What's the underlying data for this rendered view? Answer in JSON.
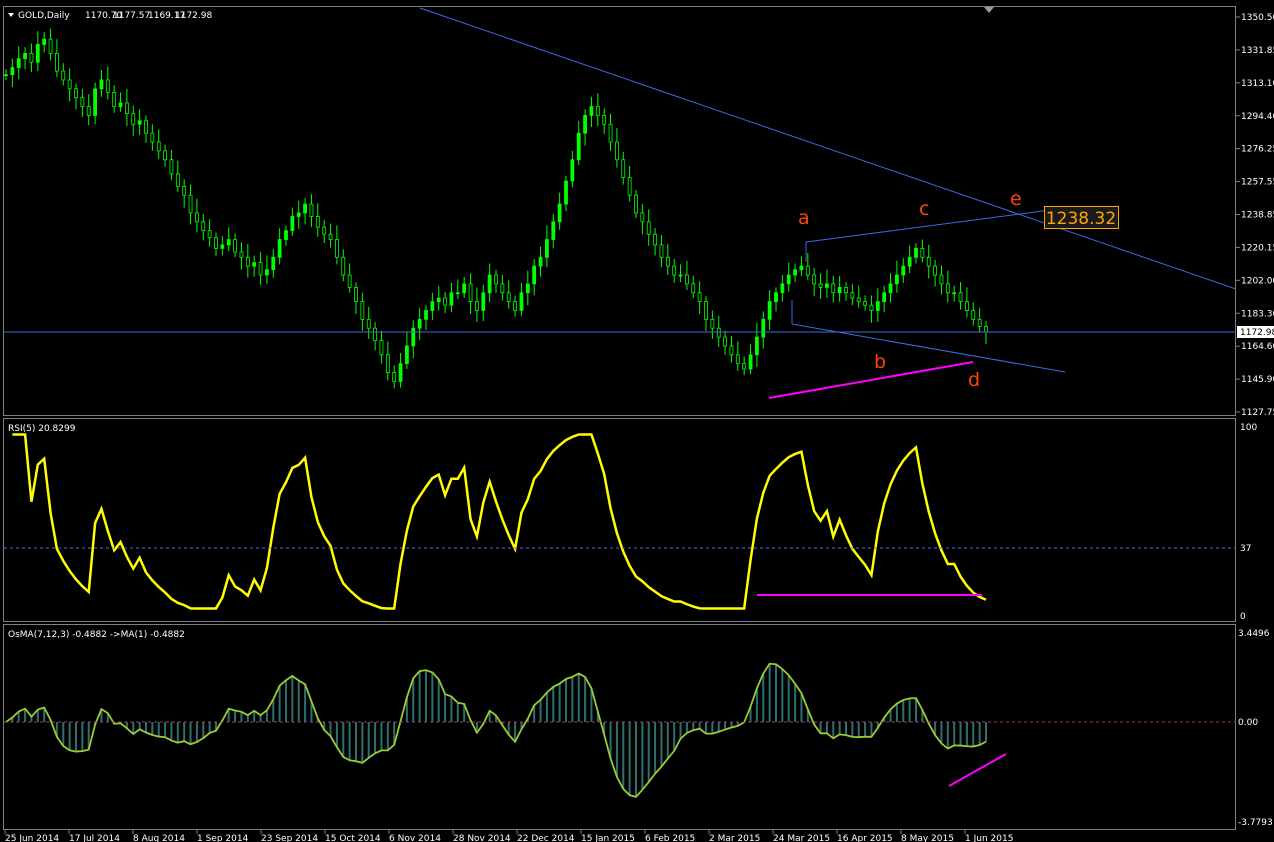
{
  "header": {
    "symbol": "GOLD,Daily",
    "open": "1170.70",
    "high": "1177.57",
    "low": "1169.17",
    "close": "1172.98"
  },
  "colors": {
    "background": "#000000",
    "candles": "#00ff00",
    "trendlines": "#4169e1",
    "waves": "#ff4500",
    "magenta": "#ff00ff",
    "rsi": "#ffff00",
    "osma_line": "#9acd32",
    "osma_hist": "#2f6f6f",
    "grid": "#808080"
  },
  "chart_data": [
    {
      "type": "candlestick",
      "name": "price",
      "ylim": [
        1127.75,
        1350.5
      ],
      "y_ticks": [
        "1350.50",
        "1331.85",
        "1313.10",
        "1294.40",
        "1276.25",
        "1257.55",
        "1238.85",
        "1220.15",
        "1202.00",
        "1183.30",
        "1164.60",
        "1145.90",
        "1127.75"
      ],
      "current_price": "1172.98",
      "price_box": "1238.32",
      "wave_labels": [
        "a",
        "b",
        "c",
        "d",
        "e"
      ],
      "x_dates": [
        "25 Jun 2014",
        "17 Jul 2014",
        "8 Aug 2014",
        "1 Sep 2014",
        "23 Sep 2014",
        "15 Oct 2014",
        "6 Nov 2014",
        "28 Nov 2014",
        "22 Dec 2014",
        "15 Jan 2015",
        "6 Feb 2015",
        "2 Mar 2015",
        "24 Mar 2015",
        "16 Apr 2015",
        "8 May 2015",
        "1 Jun 2015"
      ],
      "close": [
        1318,
        1322,
        1327,
        1330,
        1325,
        1335,
        1338,
        1330,
        1320,
        1315,
        1310,
        1305,
        1300,
        1295,
        1310,
        1315,
        1308,
        1300,
        1302,
        1296,
        1290,
        1292,
        1285,
        1280,
        1275,
        1270,
        1262,
        1255,
        1250,
        1240,
        1235,
        1230,
        1226,
        1220,
        1222,
        1225,
        1218,
        1215,
        1210,
        1212,
        1205,
        1208,
        1215,
        1225,
        1230,
        1238,
        1240,
        1245,
        1238,
        1232,
        1228,
        1225,
        1215,
        1205,
        1198,
        1190,
        1180,
        1175,
        1168,
        1160,
        1150,
        1145,
        1155,
        1165,
        1175,
        1180,
        1185,
        1190,
        1192,
        1188,
        1195,
        1195,
        1200,
        1190,
        1185,
        1195,
        1205,
        1200,
        1195,
        1190,
        1185,
        1195,
        1200,
        1210,
        1215,
        1225,
        1235,
        1245,
        1258,
        1270,
        1285,
        1295,
        1300,
        1295,
        1290,
        1280,
        1270,
        1260,
        1250,
        1240,
        1235,
        1228,
        1222,
        1215,
        1210,
        1205,
        1205,
        1200,
        1195,
        1190,
        1180,
        1175,
        1170,
        1165,
        1160,
        1155,
        1152,
        1160,
        1170,
        1180,
        1190,
        1195,
        1200,
        1205,
        1208,
        1210,
        1205,
        1200,
        1198,
        1200,
        1195,
        1198,
        1195,
        1192,
        1190,
        1188,
        1185,
        1190,
        1195,
        1200,
        1205,
        1210,
        1215,
        1220,
        1215,
        1210,
        1205,
        1200,
        1195,
        1195,
        1190,
        1185,
        1180,
        1176,
        1173
      ],
      "rsi": {
        "label": "RSI(5) 20.8299",
        "ylim": [
          0,
          100
        ],
        "ticks": [
          "100",
          "37",
          "0"
        ],
        "level": 37
      },
      "osma": {
        "label": "OsMA(7,12,3) -0.4882  ->MA(1) -0.4882",
        "ylim": [
          -3.7793,
          3.4496
        ],
        "ticks": [
          "3.4496",
          "0.00",
          "-3.7793"
        ]
      }
    }
  ]
}
